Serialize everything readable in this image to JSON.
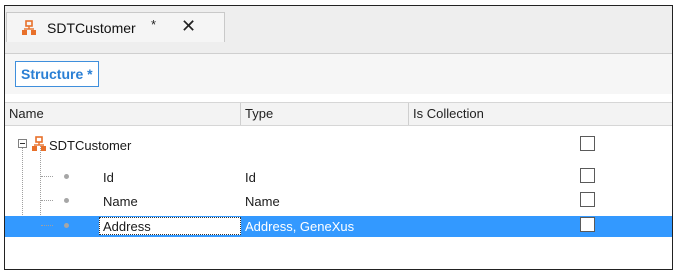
{
  "tab": {
    "title": "SDTCustomer",
    "dirty_marker": "*",
    "close_glyph": "✕",
    "icon": "sdt-structure-icon"
  },
  "subtabs": {
    "structure_label": "Structure *"
  },
  "columns": {
    "name": "Name",
    "type": "Type",
    "collection": "Is Collection"
  },
  "root": {
    "name": "SDTCustomer",
    "expander": "minus",
    "icon": "sdt-structure-icon"
  },
  "rows": [
    {
      "name": "Id",
      "type": "Id",
      "is_collection": false
    },
    {
      "name": "Name",
      "type": "Name",
      "is_collection": false
    },
    {
      "name": "Address",
      "type": "Address, GeneXus",
      "is_collection": false,
      "selected": true
    }
  ],
  "colors": {
    "selection": "#3399ff",
    "accent": "#2a7fd4",
    "sdt_icon": "#e8702a"
  }
}
